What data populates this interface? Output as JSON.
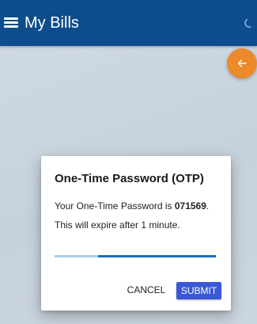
{
  "appbar": {
    "title": "My Bills",
    "menu_icon": "hamburger-menu-icon",
    "status_icon": "loading-spinner-icon",
    "background_color": "#0d4d8c"
  },
  "fab": {
    "icon": "arrow-left-icon",
    "color": "#ec8a2b"
  },
  "dialog": {
    "title": "One-Time Password (OTP)",
    "message_prefix": "Your One-Time Password is ",
    "otp_code": "071569",
    "message_suffix": ".",
    "expiry_text": "This will expire after 1 minute.",
    "progress_remaining_fraction": 0.73,
    "progress_color": "#1a6cc0",
    "progress_track_color": "#a9cdef",
    "cancel_label": "CANCEL",
    "submit_label": "SUBMIT",
    "submit_color": "#3a57d6"
  }
}
